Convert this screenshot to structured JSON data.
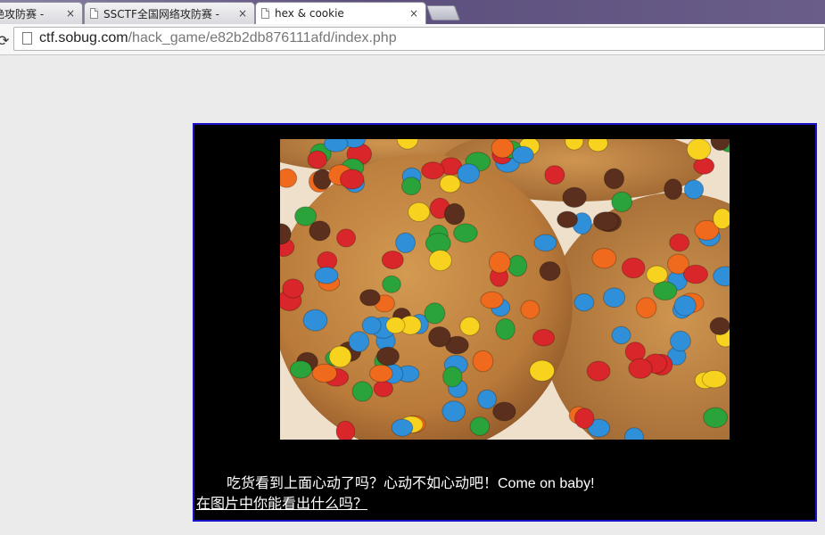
{
  "browser": {
    "tabs": [
      {
        "title": "绝攻防赛 -",
        "active": false
      },
      {
        "title": "SSCTF全国网络攻防赛 -",
        "active": false
      },
      {
        "title": "hex & cookie",
        "active": true
      }
    ],
    "close_glyph": "×",
    "address": {
      "host": "ctf.sobug.com",
      "path": "/hack_game/e82b2db876111afd/index.php"
    },
    "toolbar_icon": "⟳"
  },
  "page": {
    "image": {
      "description_icon": "cookie-photo",
      "bg_color": "#ead9c4"
    },
    "caption": "吃货看到上面心动了吗？心动不如心动吧！Come on baby!",
    "link_text": "在图片中你能看出什么吗？",
    "box_color": "#000000",
    "border_color": "#1a12c8"
  }
}
